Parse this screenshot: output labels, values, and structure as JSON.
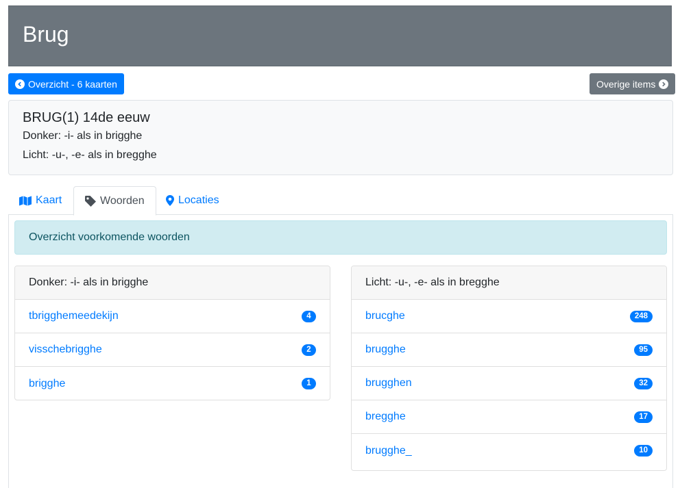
{
  "page": {
    "title": "Brug"
  },
  "nav": {
    "back_label": "Overzicht - 6 kaarten",
    "other_label": "Overige items"
  },
  "info": {
    "title": "BRUG(1) 14de eeuw",
    "dark": "Donker: -i- als in brigghe",
    "light": "Licht: -u-, -e- als in bregghe"
  },
  "tabs": [
    {
      "label": "Kaart",
      "icon": "map-icon"
    },
    {
      "label": "Woorden",
      "icon": "tag-icon"
    },
    {
      "label": "Locaties",
      "icon": "map-marker-icon"
    }
  ],
  "alert": {
    "text": "Overzicht voorkomende woorden"
  },
  "left_list": {
    "header": "Donker: -i- als in brigghe",
    "items": [
      {
        "word": "tbrigghemeedekijn",
        "count": "4"
      },
      {
        "word": "visschebrigghe",
        "count": "2"
      },
      {
        "word": "brigghe",
        "count": "1"
      }
    ]
  },
  "right_list": {
    "header": "Licht: -u-, -e- als in bregghe",
    "items": [
      {
        "word": "brucghe",
        "count": "248"
      },
      {
        "word": "brugghe",
        "count": "95"
      },
      {
        "word": "brugghen",
        "count": "32"
      },
      {
        "word": "bregghe",
        "count": "17"
      },
      {
        "word": "brugghe_",
        "count": "10"
      }
    ]
  },
  "colors": {
    "primary": "#007bff",
    "secondary": "#6c757d",
    "alert_bg": "#d1ecf1",
    "alert_text": "#0c5460"
  }
}
